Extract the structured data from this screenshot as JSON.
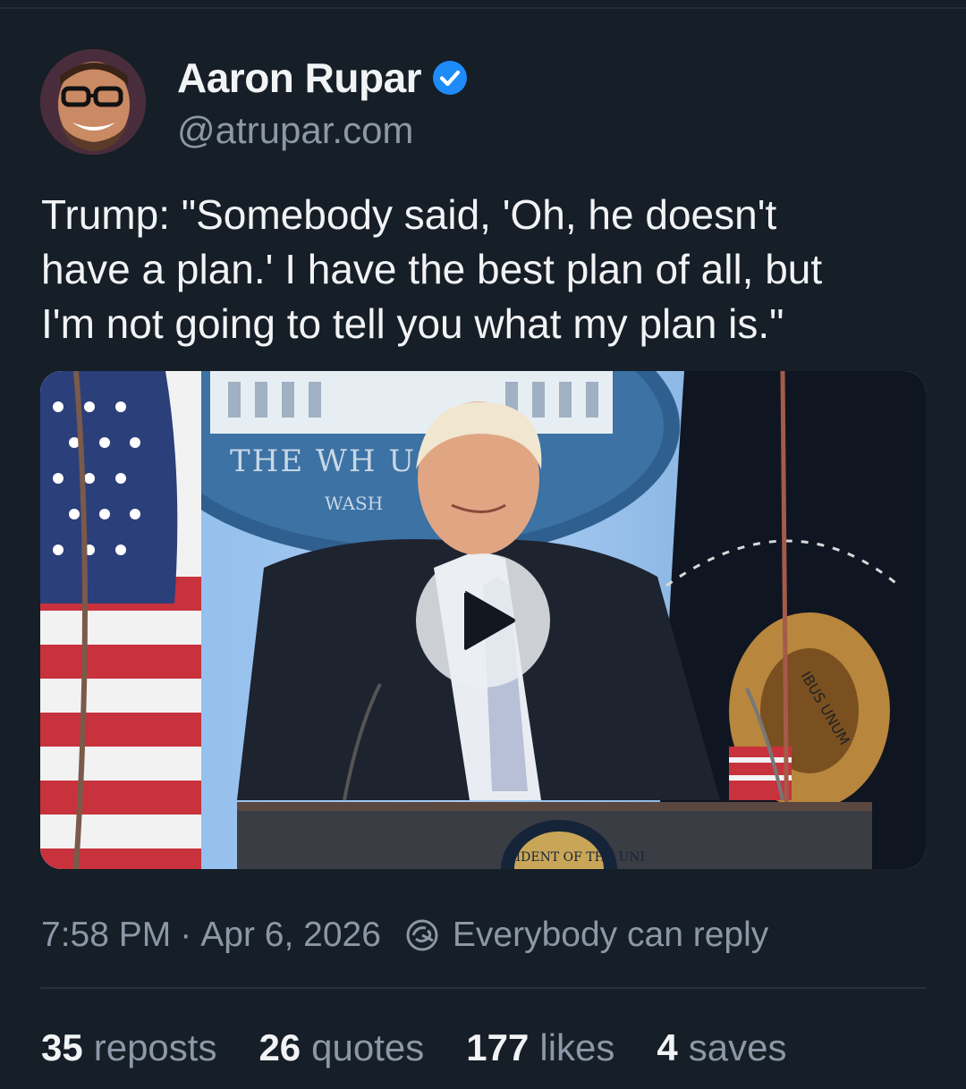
{
  "author": {
    "display_name": "Aaron Rupar",
    "handle": "@atrupar.com",
    "verified_icon": "verified-check-icon",
    "verified_color": "#1d8cf8"
  },
  "post": {
    "text": "Trump: \"Somebody said, 'Oh, he doesn't\nhave a plan.' I have the best plan of all, but\nI'm not going to tell you what my plan is.\""
  },
  "media": {
    "type": "video",
    "play_icon": "play-icon",
    "seal_text": "THE WH     USE",
    "seal_subtext": "WASH",
    "podium_seal_text": "SIDENT OF THE UNI",
    "flag_motto": "IBUS UNUM"
  },
  "meta": {
    "time": "7:58 PM",
    "separator": "·",
    "date": "Apr 6, 2026",
    "reply_icon": "reply-setting-icon",
    "reply_setting": "Everybody can reply"
  },
  "stats": {
    "reposts_count": "35",
    "reposts_label": "reposts",
    "quotes_count": "26",
    "quotes_label": "quotes",
    "likes_count": "177",
    "likes_label": "likes",
    "saves_count": "4",
    "saves_label": "saves"
  },
  "colors": {
    "background": "#161e27",
    "primary_text": "#f1f3f5",
    "secondary_text": "#8b98a6"
  }
}
